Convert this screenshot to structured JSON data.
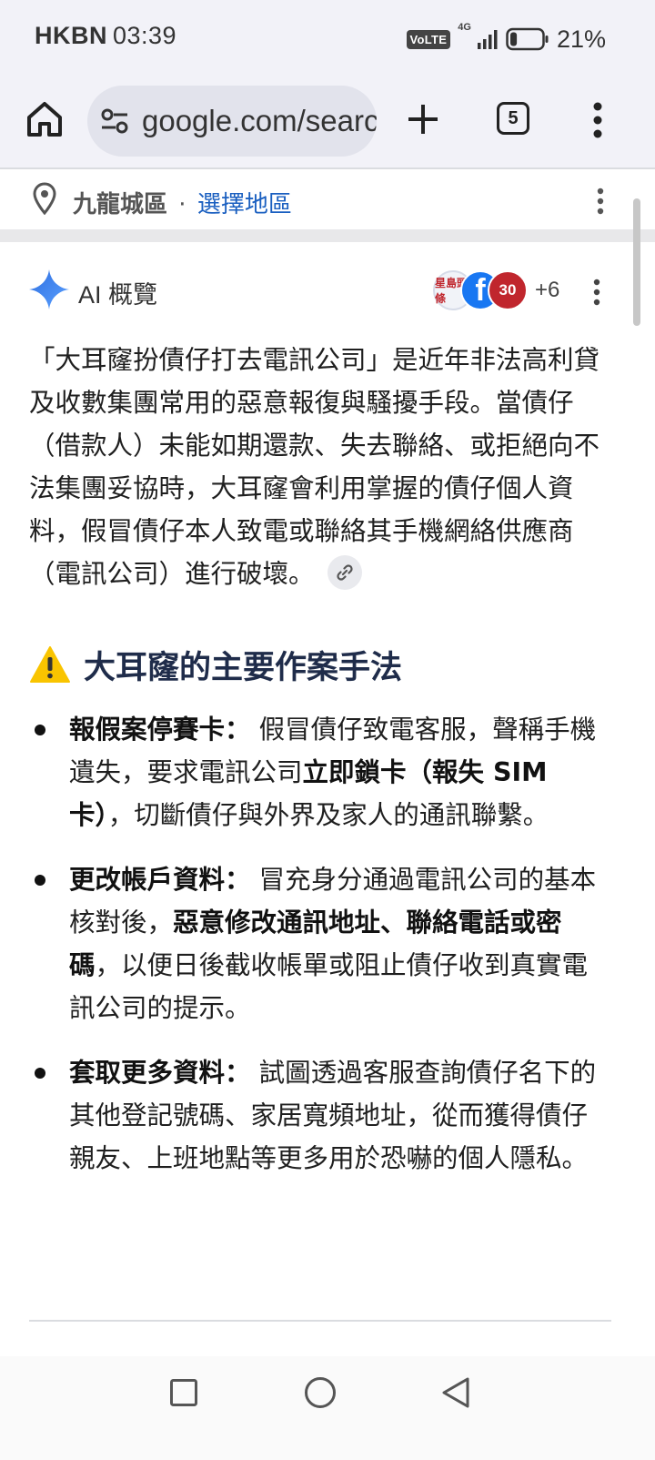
{
  "status_bar": {
    "carrier": "HKBN",
    "time": "03:39",
    "volte_label": "VoLTE",
    "network_label": "4G",
    "battery_percent": "21%",
    "battery_level": 0.21
  },
  "browser": {
    "url": "google.com/search",
    "tab_count": "5"
  },
  "location": {
    "place": "九龍城區",
    "separator": "·",
    "choose_link": "選擇地區"
  },
  "ai_overview": {
    "title": "AI 概覽",
    "sources": [
      {
        "label": "星島頭條",
        "color": "#c0262d"
      },
      {
        "label": "f",
        "color": "#1877f2"
      },
      {
        "label": "30",
        "color": "#c0262d"
      }
    ],
    "more_sources": "+6",
    "intro": "「大耳窿扮債仔打去電訊公司」是近年非法高利貸及收數集團常用的惡意報復與騷擾手段。當債仔（借款人）未能如期還款、失去聯絡、或拒絕向不法集團妥協時，大耳窿會利用掌握的債仔個人資料，假冒債仔本人致電或聯絡其手機網絡供應商（電訊公司）進行破壞。",
    "section_heading": "大耳窿的主要作案手法",
    "bullets": [
      {
        "title": "報假案停賽卡：",
        "text_before": " 假冒債仔致電客服，聲稱手機遺失，要求電訊公司",
        "emphasis": "立即鎖卡（報失 SIM 卡）",
        "text_after": "，切斷債仔與外界及家人的通訊聯繫。"
      },
      {
        "title": "更改帳戶資料：",
        "text_before": " 冒充身分通過電訊公司的基本核對後，",
        "emphasis": "惡意修改通訊地址、聯絡電話或密碼",
        "text_after": "，以便日後截收帳單或阻止債仔收到真實電訊公司的提示。"
      },
      {
        "title": "套取更多資料：",
        "text_before": " 試圖透過客服查詢債仔名下的其他登記號碼、家居寬頻地址，從而獲得債仔親友、上班地點等更多用於恐嚇的個人隱私。",
        "emphasis": "",
        "text_after": ""
      }
    ]
  },
  "icons": {
    "home": "home-icon",
    "site_info": "tune-icon",
    "new_tab": "plus-icon",
    "menu": "more-vert-icon",
    "location": "location-pin-icon",
    "sparkle": "gemini-sparkle-icon",
    "link": "link-icon",
    "warning": "warning-icon"
  },
  "colors": {
    "link_blue": "#1a5fc0",
    "sparkle_blue": "#4285f4",
    "heading_navy": "#1f2c4a",
    "warning_yellow": "#f9c400"
  }
}
